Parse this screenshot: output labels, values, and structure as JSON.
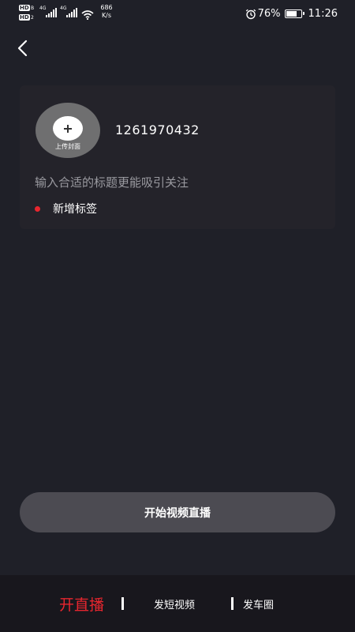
{
  "status_bar": {
    "hd1": "HD",
    "hd1_sub": "B",
    "hd2": "HD",
    "hd2_sub": "2",
    "net1": "4G",
    "net2": "4G",
    "speed_value": "686",
    "speed_unit": "K/s",
    "battery_percent": "76%",
    "battery_level": 0.76,
    "time": "11:26",
    "icons": [
      "alarm-icon",
      "battery-icon",
      "wifi-icon",
      "signal-icon"
    ]
  },
  "header": {
    "back_icon": "chevron-left-icon"
  },
  "card": {
    "cover_label": "上传封面",
    "cover_icon": "plus-icon",
    "room_id": "1261970432",
    "title_placeholder": "输入合适的标题更能吸引关注",
    "title_value": "",
    "add_tag_label": "新增标签",
    "tag_dot_color": "#e8262e"
  },
  "actions": {
    "start_live_label": "开始视频直播"
  },
  "bottom_nav": {
    "tabs": [
      {
        "label": "开直播",
        "active": true
      },
      {
        "label": "发短视频",
        "active": false
      },
      {
        "label": "发车圈",
        "active": false
      }
    ],
    "active_color": "#e8262e"
  }
}
